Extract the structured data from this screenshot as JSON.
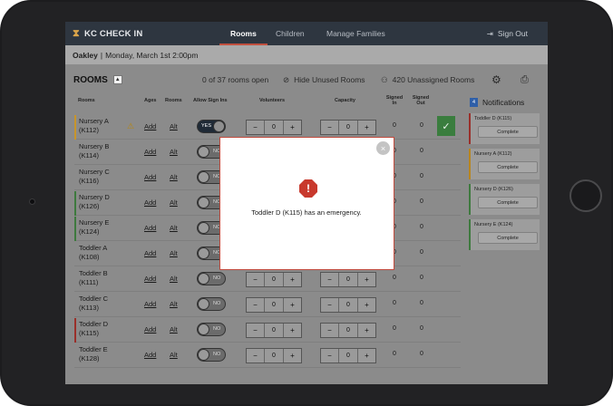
{
  "app": {
    "brand": "KC CHECK IN",
    "brand_icon": "hourglass-logo-icon",
    "accent": "#c2503f"
  },
  "nav": {
    "tabs": [
      "Rooms",
      "Children",
      "Manage Families"
    ],
    "active": "Rooms",
    "signout": "Sign Out"
  },
  "info": {
    "location": "Oakley",
    "sep": "|",
    "datetime": "Monday, March 1st  2:00pm"
  },
  "toolbar": {
    "title": "ROOMS",
    "open": "0 of 37 rooms open",
    "hide": "Hide Unused Rooms",
    "unassigned": "420 Unassigned Rooms"
  },
  "headers": {
    "rooms": "Rooms",
    "ages": "Ages",
    "rooms2": "Rooms",
    "allow": "Allow Sign Ins",
    "volunteers": "Volunteers",
    "capacity": "Capacity",
    "signed_in": "Signed In",
    "signed_out": "Signed Out"
  },
  "rows": [
    {
      "name": "Nursery A",
      "code": "(K112)",
      "stripe": "#c8952b",
      "warn": true,
      "toggle": "YES",
      "vol": "0",
      "cap": "0",
      "in": "0",
      "out": "0",
      "check": true
    },
    {
      "name": "Nursery B",
      "code": "(K114)",
      "stripe": "",
      "toggle": "NO",
      "vol": "0",
      "cap": "0",
      "in": "0",
      "out": "0"
    },
    {
      "name": "Nursery C",
      "code": "(K116)",
      "stripe": "",
      "toggle": "NO",
      "vol": "0",
      "cap": "0",
      "in": "0",
      "out": "0"
    },
    {
      "name": "Nursery D",
      "code": "(K126)",
      "stripe": "#3e7a3e",
      "toggle": "NO",
      "vol": "0",
      "cap": "0",
      "in": "0",
      "out": "0"
    },
    {
      "name": "Nursery E",
      "code": "(K124)",
      "stripe": "#3e7a3e",
      "toggle": "NO",
      "vol": "0",
      "cap": "0",
      "in": "0",
      "out": "0"
    },
    {
      "name": "Toddler A",
      "code": "(K108)",
      "stripe": "",
      "toggle": "NO",
      "vol": "0",
      "cap": "0",
      "in": "0",
      "out": "0"
    },
    {
      "name": "Toddler B",
      "code": "(K111)",
      "stripe": "",
      "toggle": "NO",
      "vol": "0",
      "cap": "0",
      "in": "0",
      "out": "0"
    },
    {
      "name": "Toddler C",
      "code": "(K113)",
      "stripe": "",
      "toggle": "NO",
      "vol": "0",
      "cap": "0",
      "in": "0",
      "out": "0"
    },
    {
      "name": "Toddler D",
      "code": "(K115)",
      "stripe": "#9a2f2a",
      "toggle": "NO",
      "vol": "0",
      "cap": "0",
      "in": "0",
      "out": "0"
    },
    {
      "name": "Toddler E",
      "code": "(K128)",
      "stripe": "",
      "toggle": "NO",
      "vol": "0",
      "cap": "0",
      "in": "0",
      "out": "0"
    }
  ],
  "row_links": {
    "add": "Add",
    "alt": "Alt"
  },
  "notifications": {
    "title": "Notifications",
    "count": "4",
    "items": [
      {
        "room": "Toddler D (K115)",
        "action": "Complete",
        "color": "red"
      },
      {
        "room": "Nursery A (K112)",
        "action": "Complete",
        "color": "amber"
      },
      {
        "room": "Nursery D (K126)",
        "action": "Complete",
        "color": "green"
      },
      {
        "room": "Nursery E (K124)",
        "action": "Complete",
        "color": "green"
      }
    ]
  },
  "modal": {
    "message": "Toddler D (K115) has an emergency.",
    "icon": "alert-octagon-icon",
    "close": "×"
  }
}
